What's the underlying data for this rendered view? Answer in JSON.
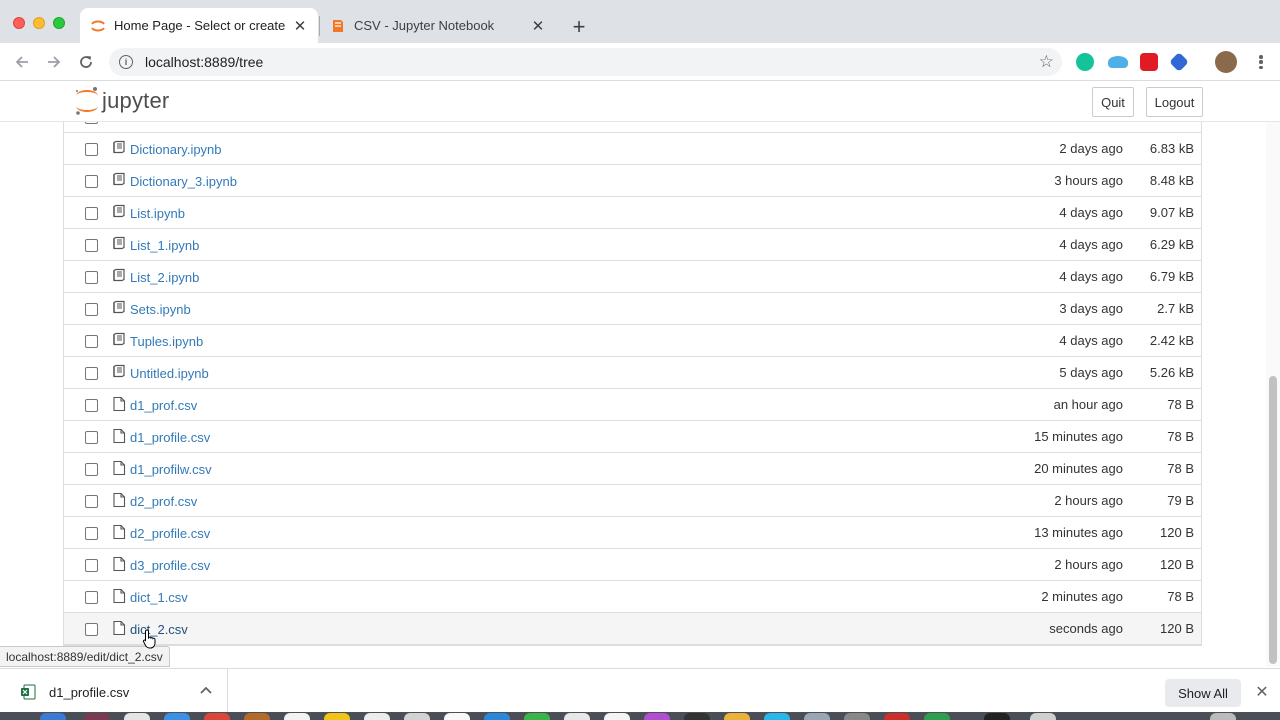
{
  "browser": {
    "tabs": [
      {
        "title": "Home Page - Select or create a notebook",
        "active": true
      },
      {
        "title": "CSV - Jupyter Notebook",
        "active": false
      }
    ],
    "url": "localhost:8889/tree"
  },
  "jupyter": {
    "logo_text": "jupyter",
    "quit_label": "Quit",
    "logout_label": "Logout"
  },
  "files": [
    {
      "name": "Dictionary.ipynb",
      "kind": "notebook",
      "modified": "2 days ago",
      "size": "6.83 kB"
    },
    {
      "name": "Dictionary_3.ipynb",
      "kind": "notebook",
      "modified": "3 hours ago",
      "size": "8.48 kB"
    },
    {
      "name": "List.ipynb",
      "kind": "notebook",
      "modified": "4 days ago",
      "size": "9.07 kB"
    },
    {
      "name": "List_1.ipynb",
      "kind": "notebook",
      "modified": "4 days ago",
      "size": "6.29 kB"
    },
    {
      "name": "List_2.ipynb",
      "kind": "notebook",
      "modified": "4 days ago",
      "size": "6.79 kB"
    },
    {
      "name": "Sets.ipynb",
      "kind": "notebook",
      "modified": "3 days ago",
      "size": "2.7 kB"
    },
    {
      "name": "Tuples.ipynb",
      "kind": "notebook",
      "modified": "4 days ago",
      "size": "2.42 kB"
    },
    {
      "name": "Untitled.ipynb",
      "kind": "notebook",
      "modified": "5 days ago",
      "size": "5.26 kB"
    },
    {
      "name": "d1_prof.csv",
      "kind": "file",
      "modified": "an hour ago",
      "size": "78 B"
    },
    {
      "name": "d1_profile.csv",
      "kind": "file",
      "modified": "15 minutes ago",
      "size": "78 B"
    },
    {
      "name": "d1_profilw.csv",
      "kind": "file",
      "modified": "20 minutes ago",
      "size": "78 B"
    },
    {
      "name": "d2_prof.csv",
      "kind": "file",
      "modified": "2 hours ago",
      "size": "79 B"
    },
    {
      "name": "d2_profile.csv",
      "kind": "file",
      "modified": "13 minutes ago",
      "size": "120 B"
    },
    {
      "name": "d3_profile.csv",
      "kind": "file",
      "modified": "2 hours ago",
      "size": "120 B"
    },
    {
      "name": "dict_1.csv",
      "kind": "file",
      "modified": "2 minutes ago",
      "size": "78 B"
    },
    {
      "name": "dict_2.csv",
      "kind": "file",
      "modified": "seconds ago",
      "size": "120 B",
      "hover": true
    }
  ],
  "status_url": "localhost:8889/edit/dict_2.csv",
  "downloads": {
    "file_name": "d1_profile.csv",
    "show_all_label": "Show All"
  },
  "colors": {
    "link": "#337ab7",
    "jupyter_orange": "#f37726",
    "tab_strip": "#dee1e6"
  }
}
